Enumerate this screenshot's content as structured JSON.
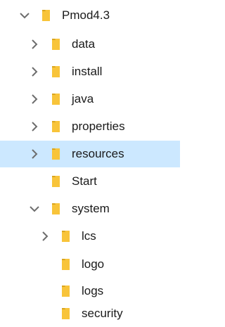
{
  "tree": {
    "items": [
      {
        "label": "Pmod4.3",
        "state": "expanded",
        "selected": false
      },
      {
        "label": "data",
        "state": "collapsed",
        "selected": false
      },
      {
        "label": "install",
        "state": "collapsed",
        "selected": false
      },
      {
        "label": "java",
        "state": "collapsed",
        "selected": false
      },
      {
        "label": "properties",
        "state": "collapsed",
        "selected": false
      },
      {
        "label": "resources",
        "state": "collapsed",
        "selected": true
      },
      {
        "label": "Start",
        "state": "leaf",
        "selected": false
      },
      {
        "label": "system",
        "state": "expanded",
        "selected": false
      },
      {
        "label": "lcs",
        "state": "collapsed",
        "selected": false
      },
      {
        "label": "logo",
        "state": "leaf",
        "selected": false
      },
      {
        "label": "logs",
        "state": "leaf",
        "selected": false
      },
      {
        "label": "security",
        "state": "leaf",
        "selected": false
      }
    ]
  },
  "colors": {
    "selection_background": "#cce8ff",
    "folder": "#f8c43a",
    "chevron": "#6d6d6d",
    "text": "#1a1a1a"
  },
  "icons": {
    "expanded": "chevron-down-icon",
    "collapsed": "chevron-right-icon",
    "folder": "folder-icon"
  }
}
